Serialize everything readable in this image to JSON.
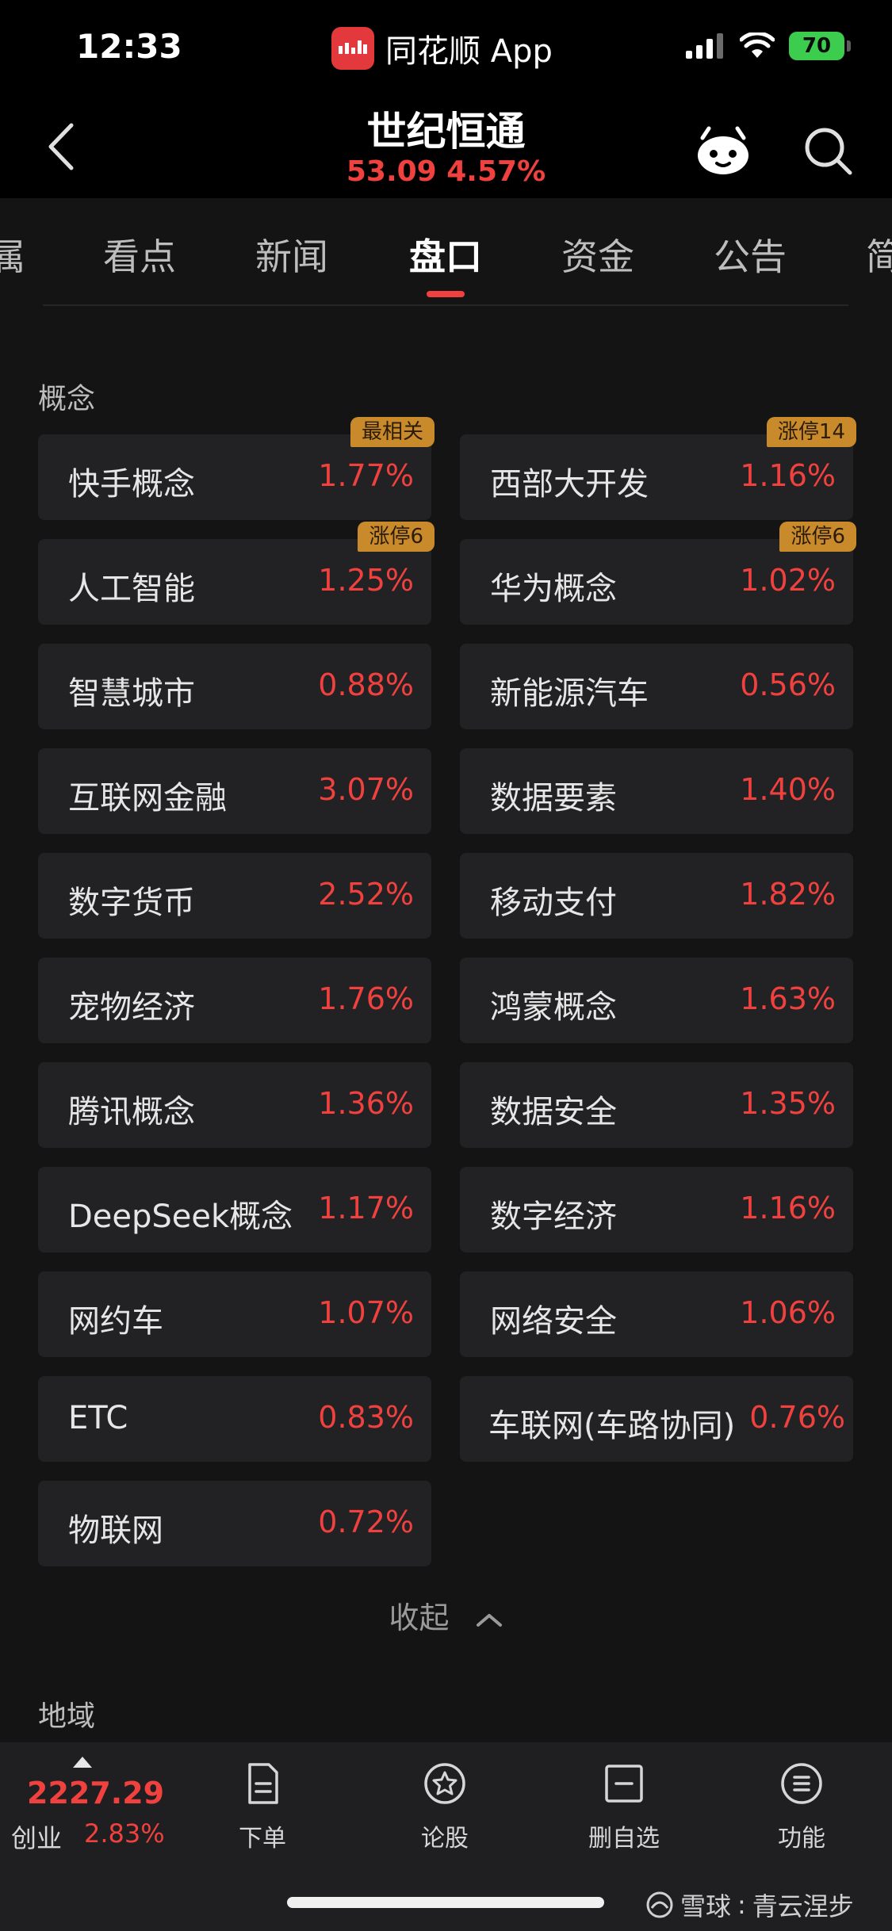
{
  "status_bar": {
    "time": "12:33",
    "app_name": "同花顺 App",
    "battery": "70"
  },
  "header": {
    "stock_name": "世纪恒通",
    "stock_quote": "53.09 4.57%"
  },
  "tabs": [
    {
      "label": "属"
    },
    {
      "label": "看点"
    },
    {
      "label": "新闻"
    },
    {
      "label": "盘口"
    },
    {
      "label": "资金"
    },
    {
      "label": "公告"
    },
    {
      "label": "简"
    }
  ],
  "concepts": {
    "title": "概念",
    "items": [
      {
        "label": "快手概念",
        "value": "1.77%",
        "badge": "最相关"
      },
      {
        "label": "西部大开发",
        "value": "1.16%",
        "badge": "涨停14"
      },
      {
        "label": "人工智能",
        "value": "1.25%",
        "badge": "涨停6"
      },
      {
        "label": "华为概念",
        "value": "1.02%",
        "badge": "涨停6"
      },
      {
        "label": "智慧城市",
        "value": "0.88%"
      },
      {
        "label": "新能源汽车",
        "value": "0.56%"
      },
      {
        "label": "互联网金融",
        "value": "3.07%"
      },
      {
        "label": "数据要素",
        "value": "1.40%"
      },
      {
        "label": "数字货币",
        "value": "2.52%"
      },
      {
        "label": "移动支付",
        "value": "1.82%"
      },
      {
        "label": "宠物经济",
        "value": "1.76%"
      },
      {
        "label": "鸿蒙概念",
        "value": "1.63%"
      },
      {
        "label": "腾讯概念",
        "value": "1.36%"
      },
      {
        "label": "数据安全",
        "value": "1.35%"
      },
      {
        "label": "DeepSeek概念",
        "value": "1.17%"
      },
      {
        "label": "数字经济",
        "value": "1.16%"
      },
      {
        "label": "网约车",
        "value": "1.07%"
      },
      {
        "label": "网络安全",
        "value": "1.06%"
      },
      {
        "label": "ETC",
        "value": "0.83%"
      },
      {
        "label": "车联网(车路协同)",
        "value": "0.76%"
      },
      {
        "label": "物联网",
        "value": "0.72%"
      }
    ]
  },
  "collapse_label": "收起",
  "region": {
    "title": "地域"
  },
  "bottom_bar": {
    "index_value": "2227.29",
    "index_name": "创业",
    "index_pct": "2.83%",
    "nav": [
      {
        "label": "下单",
        "icon": "document-icon"
      },
      {
        "label": "论股",
        "icon": "star-badge-icon"
      },
      {
        "label": "删自选",
        "icon": "minus-box-icon"
      },
      {
        "label": "功能",
        "icon": "menu-circle-icon"
      }
    ]
  },
  "watermark": {
    "brand": "雪球",
    "sep": ":",
    "author": "青云涅步"
  },
  "colors": {
    "rise": "#f0413f",
    "badge": "#c98a2c",
    "cell_bg": "#222224",
    "bg": "#141414"
  }
}
